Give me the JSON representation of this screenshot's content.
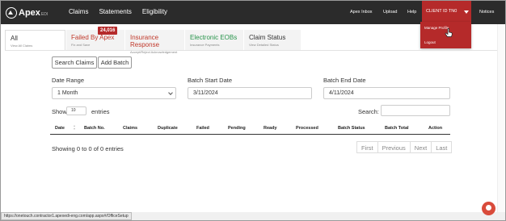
{
  "brand": {
    "name": "Apex",
    "sup": "EDI"
  },
  "nav": {
    "main": [
      "Claims",
      "Statements",
      "Eligibility"
    ],
    "inbox": "Apex Inbox",
    "upload": "Upload",
    "help": "Help",
    "client": "CLIENT ID TN0",
    "notices": "Notices"
  },
  "dropdown": {
    "item1": "Manage Profile",
    "item2": "Logout"
  },
  "tabs": [
    {
      "title": "All",
      "sub": "View All Claims",
      "color": "#333333"
    },
    {
      "title": "Failed By Apex",
      "sub": "Fix and Save",
      "color": "#c0392b"
    },
    {
      "title": "Insurance Response",
      "sub": "Accept/Reject Acknowledgement",
      "color": "#c0392b"
    },
    {
      "title": "Electronic EOBs",
      "sub": "Insurance Payments",
      "color": "#27944a"
    },
    {
      "title": "Claim Status",
      "sub": "View Detailed Status",
      "color": "#333333"
    }
  ],
  "badge": "24,016",
  "buttons": {
    "search": "Search Claims",
    "add": "Add Batch"
  },
  "filters": {
    "date_range_label": "Date Range",
    "date_range_value": "1 Month",
    "start_label": "Batch Start Date",
    "start_value": "3/11/2024",
    "end_label": "Batch End Date",
    "end_value": "4/11/2024"
  },
  "show": {
    "prefix": "Show",
    "value": "10",
    "suffix": "entries",
    "search_label": "Search:"
  },
  "columns": [
    "Date",
    "Batch No.",
    "Claims",
    "Duplicate",
    "Failed",
    "Pending",
    "Ready",
    "Processed",
    "Batch Status",
    "Batch Total",
    "Action"
  ],
  "info": "Showing 0 to 0 of 0 entries",
  "pager": [
    "First",
    "Previous",
    "Next",
    "Last"
  ],
  "status_url": "https://onetouch.contractor1.apexedi-eng.com/app.aspx#/OfficeSetup"
}
